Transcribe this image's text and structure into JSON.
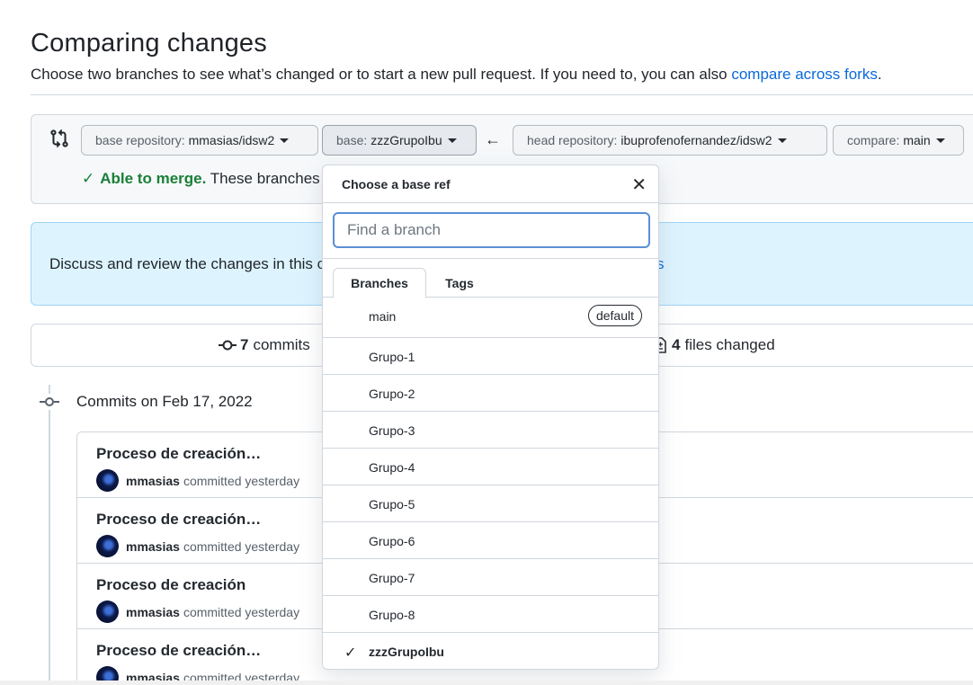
{
  "page": {
    "title": "Comparing changes",
    "subtitle": "Choose two branches to see what’s changed or to start a new pull request. If you need to, you can also",
    "subtitle_link": "compare across forks",
    "subtitle_end": "."
  },
  "range": {
    "base_repo_label": "base repository:",
    "base_repo_value": "mmasias/idsw2",
    "base_label": "base:",
    "base_value": "zzzGrupoIbu",
    "head_repo_label": "head repository:",
    "head_repo_value": "ibuprofenofernandez/idsw2",
    "compare_label": "compare:",
    "compare_value": "main",
    "merge_status_strong": "Able to merge.",
    "merge_status_text": "These branches"
  },
  "info": {
    "text": "Discuss and review the changes in this c",
    "tail": "s"
  },
  "summary": {
    "commits_count": "7",
    "commits_label": "commits",
    "files_count": "4",
    "files_label": "files changed"
  },
  "timeline": {
    "date_label": "Commits on Feb 17, 2022"
  },
  "commits": [
    {
      "title": "Proceso de creación…",
      "author": "mmasias",
      "action": "committed yesterday"
    },
    {
      "title": "Proceso de creación…",
      "author": "mmasias",
      "action": "committed yesterday"
    },
    {
      "title": "Proceso de creación",
      "author": "mmasias",
      "action": "committed yesterday"
    },
    {
      "title": "Proceso de creación…",
      "author": "mmasias",
      "action": "committed yesterday"
    }
  ],
  "dropdown": {
    "title": "Choose a base ref",
    "filter_placeholder": "Find a branch",
    "tabs": [
      "Branches",
      "Tags"
    ],
    "default_badge": "default",
    "items": [
      "main",
      "Grupo-1",
      "Grupo-2",
      "Grupo-3",
      "Grupo-4",
      "Grupo-5",
      "Grupo-6",
      "Grupo-7",
      "Grupo-8",
      "zzzGrupoIbu"
    ],
    "selected": "zzzGrupoIbu"
  },
  "icons": {
    "compare": "git-compare-icon",
    "arrow": "arrow-left-icon",
    "check": "check-icon",
    "close": "x-icon",
    "commit": "git-commit-icon",
    "file_diff": "file-diff-icon"
  },
  "colors": {
    "success": "#1a7f37",
    "link": "#0969da",
    "info_bg": "#ddf4ff",
    "border": "#d0d7de"
  }
}
